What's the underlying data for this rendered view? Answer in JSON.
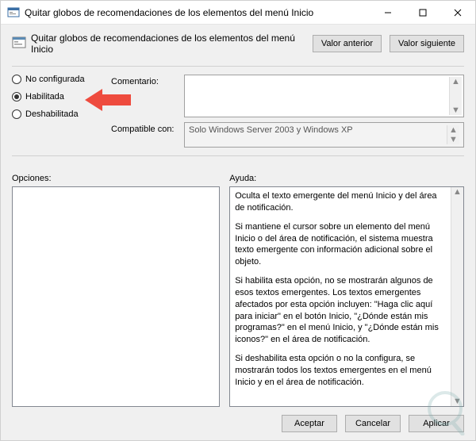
{
  "window": {
    "title": "Quitar globos de recomendaciones de los elementos del menú Inicio"
  },
  "subtitle": "Quitar globos de recomendaciones de los elementos del menú Inicio",
  "nav": {
    "prev": "Valor anterior",
    "next": "Valor siguiente"
  },
  "radios": {
    "not_configured": "No configurada",
    "enabled": "Habilitada",
    "disabled": "Deshabilitada",
    "selected": "enabled"
  },
  "fields": {
    "comment_label": "Comentario:",
    "comment_value": "",
    "compat_label": "Compatible con:",
    "compat_value": "Solo Windows Server 2003 y Windows XP"
  },
  "sections": {
    "options_label": "Opciones:",
    "help_label": "Ayuda:"
  },
  "help": {
    "p1": "Oculta el texto emergente del menú Inicio y del área de notificación.",
    "p2": "Si mantiene el cursor sobre un elemento del menú Inicio o del área de notificación, el sistema muestra texto emergente con información adicional sobre el objeto.",
    "p3": "Si habilita esta opción, no se mostrarán algunos de esos textos emergentes. Los textos emergentes afectados por esta opción incluyen: \"Haga clic aquí para iniciar\" en el botón Inicio, \"¿Dónde están mis programas?\" en el menú Inicio, y \"¿Dónde están mis iconos?\" en el área de notificación.",
    "p4": "Si deshabilita esta opción o no la configura, se mostrarán todos los textos emergentes en el menú Inicio y en el área de notificación."
  },
  "footer": {
    "ok": "Aceptar",
    "cancel": "Cancelar",
    "apply": "Aplicar"
  }
}
